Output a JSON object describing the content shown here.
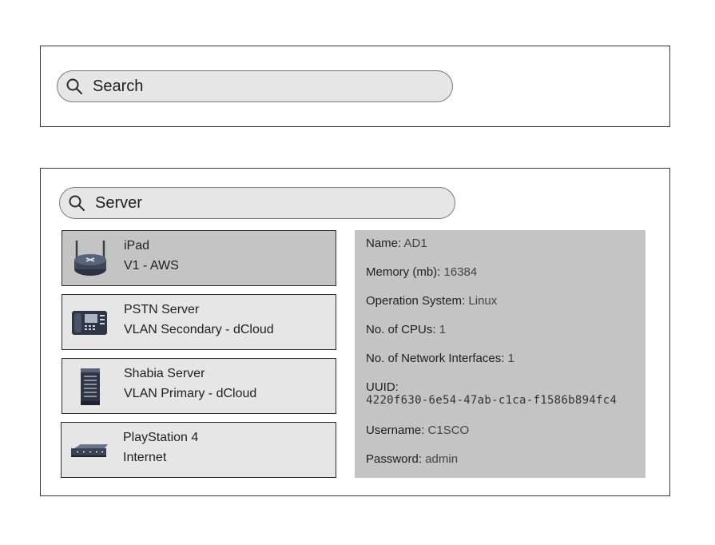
{
  "top_search": {
    "value": "Search",
    "icon": "search-icon"
  },
  "main_search": {
    "value": "Server",
    "icon": "search-icon"
  },
  "devices": [
    {
      "name": "iPad",
      "network": "V1 - AWS",
      "icon": "wireless-router-icon",
      "selected": true
    },
    {
      "name": "PSTN Server",
      "network": "VLAN Secondary - dCloud",
      "icon": "ip-phone-icon",
      "selected": false
    },
    {
      "name": "Shabia Server",
      "network": "VLAN Primary - dCloud",
      "icon": "server-tower-icon",
      "selected": false
    },
    {
      "name": "PlayStation 4",
      "network": "Internet",
      "icon": "network-switch-icon",
      "selected": false
    }
  ],
  "details": {
    "name_label": "Name:",
    "name_value": "AD1",
    "memory_label": "Memory (mb):",
    "memory_value": "16384",
    "os_label": "Operation System:",
    "os_value": "Linux",
    "cpus_label": "No. of CPUs:",
    "cpus_value": "1",
    "nics_label": "No. of Network Interfaces:",
    "nics_value": "1",
    "uuid_label": "UUID:",
    "uuid_value": "4220f630-6e54-47ab-c1ca-f1586b894fc4",
    "username_label": "Username:",
    "username_value": "C1SCO",
    "password_label": "Password:",
    "password_value": "admin"
  },
  "colors": {
    "selected_card": "#c4c4c4",
    "card": "#e6e6e6",
    "details_bg": "#c4c4c4",
    "search_bg": "#e6e6e6"
  }
}
